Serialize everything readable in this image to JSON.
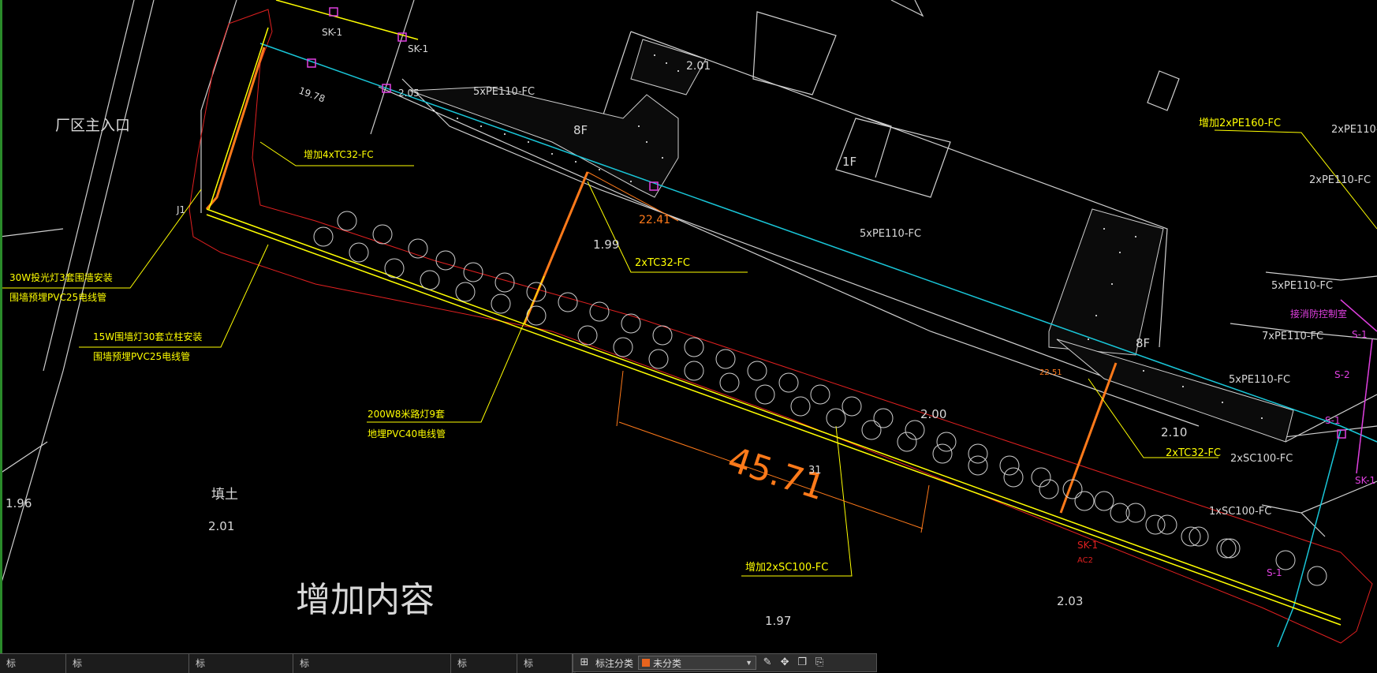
{
  "drawing": {
    "labels": {
      "main_entrance": "厂区主入口",
      "pe110_5_top": "5xPE110-FC",
      "add_tc32_4": "增加4xTC32-FC",
      "floor_8f_a": "8F",
      "floor_8f_b": "8F",
      "floor_1f": "1F",
      "tc32_2_a": "2xTC32-FC",
      "tc32_2_b": "2xTC32-FC",
      "pe110_5_mid": "5xPE110-FC",
      "add_pe160_2": "增加2xPE160-FC",
      "pe110_2_a": "2xPE110-",
      "pe110_2_b": "2xPE110-FC",
      "pe110_5_right": "5xPE110-FC",
      "pe110_7": "7xPE110-FC",
      "pe110_5_right2": "5xPE110-FC",
      "sc100_2": "2xSC100-FC",
      "sc100_1": "1xSC100-FC",
      "add_sc100_2": "增加2xSC100-FC",
      "light30_1": "30W投光灯3套围墙安装",
      "light30_2": "围墙预埋PVC25电线管",
      "light15_1": "15W围墙灯30套立柱安装",
      "light15_2": "围墙预埋PVC25电线管",
      "light200_1": "200W8米路灯9套",
      "light200_2": "地埋PVC40电线管",
      "fill": "填土",
      "added_content": "增加内容",
      "dim_4571": "45.71",
      "dim_2241": "22.41",
      "dim_1978": "19.78",
      "dim_2251": "22.51",
      "elev_199": "1.99",
      "elev_200": "2.00",
      "elev_210": "2.10",
      "elev_196": "1.96",
      "elev_201": "2.01",
      "elev_203": "2.03",
      "elev_197": "1.97",
      "elev_205": "2.05",
      "elev_201b": "2.01",
      "sk1_a": "SK-1",
      "sk1_b": "SK-1",
      "sk1_c": "SK-1",
      "sk1_d": "SK-1",
      "ac2": "AC2",
      "j1": "J1",
      "s1": "S-1",
      "s2": "S-2",
      "s1b": "S-1",
      "s1c": "S-1",
      "magenta_note": "接消防控制室",
      "scale_31": "31"
    }
  },
  "bottom_tabs": [
    "标",
    "标",
    "标",
    "标",
    "标",
    "标"
  ],
  "annotation_toolbar": {
    "label": "标注分类",
    "selected": "未分类",
    "accent": "#e8641e"
  },
  "colors": {
    "background": "#000000",
    "yellow": "#ffff00",
    "orange": "#ff7a1a",
    "cyan": "#19c6d8",
    "red": "#e02020",
    "magenta": "#e040e0",
    "white_line": "#d8d8d8"
  }
}
